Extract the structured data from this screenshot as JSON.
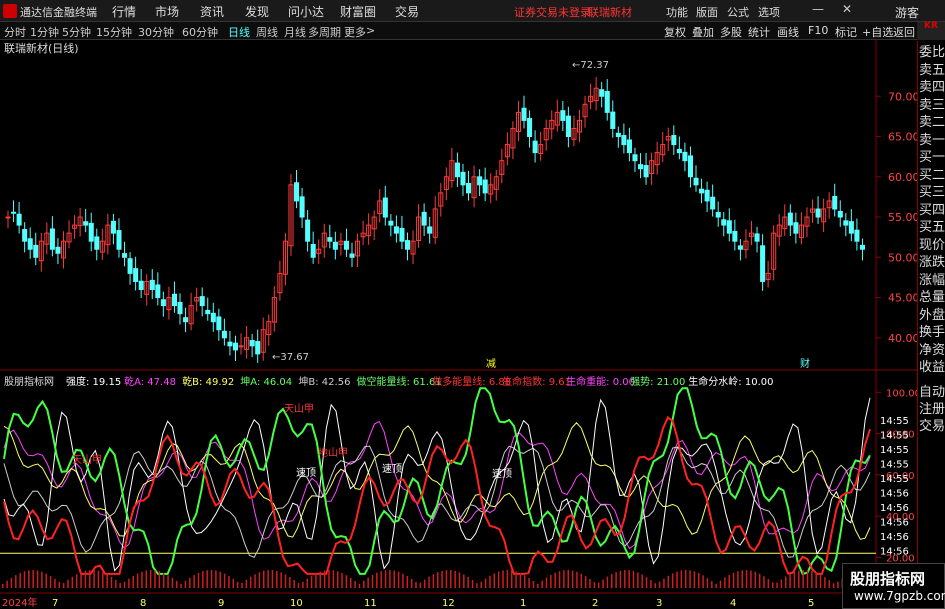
{
  "app": {
    "name": "通达信金融终端",
    "login_status": "证券交易未登录",
    "stock_name": "联瑞新材",
    "guest": "游客"
  },
  "menu": [
    "行情",
    "市场",
    "资讯",
    "发现",
    "问小达",
    "财富圈",
    "交易"
  ],
  "right_menu": [
    "功能",
    "版面",
    "公式",
    "选项"
  ],
  "periods": [
    "分时",
    "1分钟",
    "5分钟",
    "15分钟",
    "30分钟",
    "60分钟",
    "日线",
    "周线",
    "月线",
    "多周期",
    "更多"
  ],
  "active_period": "日线",
  "right_tools": [
    "复权",
    "叠加",
    "多股",
    "统计",
    "画线",
    "F10",
    "标记",
    "+自选",
    "返回"
  ],
  "chart_title": "联瑞新材(日线)",
  "price_axis": [
    "70.00",
    "65.00",
    "60.00",
    "55.00",
    "50.00",
    "45.00",
    "40.00"
  ],
  "annotations": {
    "high": "72.37",
    "low": "37.67",
    "reduce_mark": "减",
    "fin_mark": "财"
  },
  "side_panel": [
    "委比",
    "卖五",
    "卖四",
    "卖三",
    "卖二",
    "卖一",
    "买一",
    "买二",
    "买三",
    "买四",
    "买五",
    "现价",
    "涨跌",
    "涨幅",
    "总量",
    "外盘",
    "换手",
    "净资",
    "收益"
  ],
  "side_panel2": [
    "自动",
    "注册",
    "交易"
  ],
  "kr_badge": "KR",
  "indicator": {
    "name": "股朋指标网",
    "items": [
      {
        "label": "强度: 19.15",
        "color": "#ffffff"
      },
      {
        "label": "乾A: 47.48",
        "color": "#ff44ff"
      },
      {
        "label": "乾B: 49.92",
        "color": "#ffff66"
      },
      {
        "label": "坤A: 46.04",
        "color": "#66ff66"
      },
      {
        "label": "坤B: 42.56",
        "color": "#cccccc"
      },
      {
        "label": "做空能量线: 61.61",
        "color": "#66ff66"
      },
      {
        "label": "做多能量线: 6.88",
        "color": "#ff3333"
      },
      {
        "label": "生命指数: 9.61",
        "color": "#ff3333"
      },
      {
        "label": "生命重能: 0.00",
        "color": "#ff44ff"
      },
      {
        "label": "强势: 21.00",
        "color": "#66ff66"
      },
      {
        "label": "生命分水岭: 10.00",
        "color": "#ffffff"
      }
    ]
  },
  "ind_axis": [
    "100.00",
    "80.00",
    "60.00",
    "40.00",
    "20.00"
  ],
  "ind_marks": [
    "天山甲",
    "天山甲",
    "地山甲",
    "速顶",
    "速顶",
    "速顶"
  ],
  "times": [
    "14:55",
    "14:55",
    "14:55",
    "14:55",
    "14:55",
    "14:56",
    "14:56",
    "14:56",
    "14:56",
    "14:56"
  ],
  "date_axis": [
    "2024年",
    "7",
    "8",
    "9",
    "10",
    "11",
    "12",
    "1",
    "2",
    "3",
    "4",
    "5"
  ],
  "watermark": {
    "line1": "股朋指标网",
    "line2": "www.7gpzb.com"
  },
  "chart_data": {
    "type": "candlestick",
    "ylim": [
      36,
      75
    ],
    "high": 72.37,
    "low": 37.67,
    "closes": [
      55,
      55.5,
      54,
      52,
      51,
      50,
      52,
      53,
      51,
      50.5,
      52,
      53,
      54,
      55,
      54,
      52,
      51,
      52,
      54,
      53,
      51,
      50,
      48,
      47,
      46,
      47,
      46,
      45,
      44,
      45,
      44,
      43,
      42,
      44,
      45,
      44,
      43,
      42,
      41,
      40,
      39,
      38.5,
      39,
      40,
      39,
      38,
      41,
      42,
      45,
      48,
      52,
      59,
      57,
      55,
      52,
      50,
      51,
      53,
      52,
      51,
      52,
      51,
      50,
      52,
      53,
      54,
      55,
      57,
      55,
      54,
      53,
      52,
      51,
      52,
      55,
      54,
      53,
      56,
      58,
      60,
      62,
      60,
      59,
      58,
      60,
      59,
      58,
      59,
      60,
      62,
      64,
      66,
      68,
      67,
      65,
      63,
      64,
      66,
      67,
      68,
      67,
      65,
      66,
      67,
      69,
      70,
      71,
      70,
      68,
      66,
      65,
      64,
      63,
      62,
      61,
      60,
      62,
      63,
      64,
      65,
      64,
      63,
      62,
      60,
      59,
      58,
      57,
      56,
      55,
      54,
      53,
      52,
      51,
      52,
      53,
      52,
      47,
      48,
      53,
      54,
      55,
      54,
      53,
      54,
      55,
      56,
      55,
      56,
      57,
      56,
      55,
      54,
      53,
      52,
      51
    ]
  },
  "colors": {
    "up": "#ff3b3b",
    "down": "#54ffff",
    "accent": "#d00000"
  }
}
